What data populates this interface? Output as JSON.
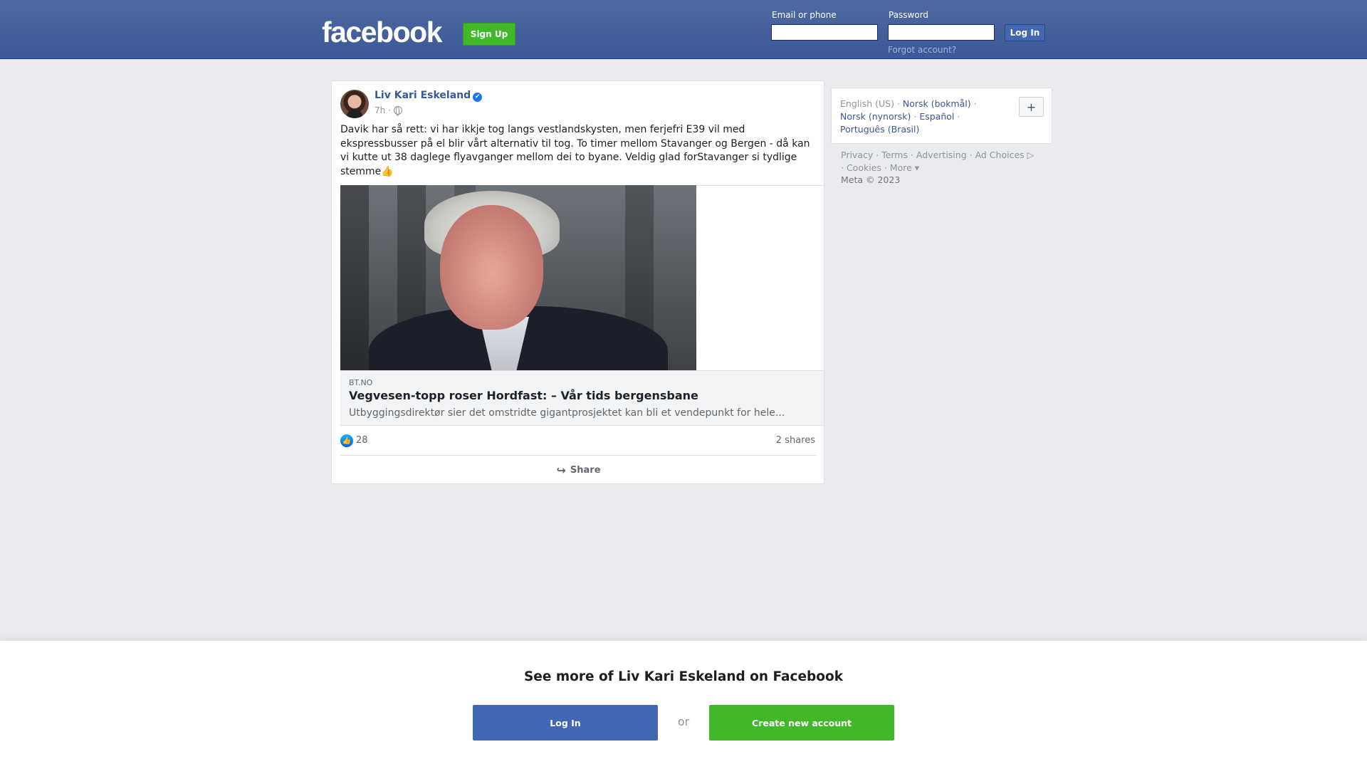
{
  "header": {
    "logo": "facebook",
    "signup_label": "Sign Up",
    "email_label": "Email or phone",
    "password_label": "Password",
    "login_label": "Log In",
    "forgot_label": "Forgot account?"
  },
  "post": {
    "author": "Liv Kari Eskeland",
    "verified_icon": "✔",
    "time": "7h",
    "separator": "·",
    "text": "Davik har så rett: vi har ikkje tog langs vestlandskysten, men ferjefri E39 vil med ekspressbusser på el blir vårt alternativ til tog. To timer mellom Stavanger og Bergen - då kan vi kutte ut 38 daglege flyavganger mellom dei to byane. Veldig glad forStavanger si tydlige stemme👍",
    "link": {
      "domain": "BT.NO",
      "title": "Vegvesen-topp roser Hordfast: – Vår tids bergensbane",
      "description": "Utbyggingsdirektør sier det omstridte gigantprosjektet kan bli et vendepunkt for hele..."
    },
    "likes": "28",
    "shares": "2 shares",
    "share_label": "Share",
    "like_icon": "👍",
    "share_icon": "↪"
  },
  "sidebar": {
    "languages": [
      {
        "label": "English (US)",
        "link": false
      },
      {
        "label": "Norsk (bokmål)",
        "link": true
      },
      {
        "label": "Norsk (nynorsk)",
        "link": true
      },
      {
        "label": "Español",
        "link": true
      },
      {
        "label": "Português (Brasil)",
        "link": true
      }
    ],
    "add_language": "+",
    "footer_links": [
      "Privacy",
      "Terms",
      "Advertising",
      "Ad Choices",
      "Cookies",
      "More"
    ],
    "copyright": "Meta © 2023"
  },
  "banner": {
    "title": "See more of Liv Kari Eskeland on Facebook",
    "login_label": "Log In",
    "or_label": "or",
    "create_label": "Create new account"
  },
  "colors": {
    "brand_blue": "#3b5998",
    "link_blue": "#385898",
    "green": "#42b72a"
  }
}
